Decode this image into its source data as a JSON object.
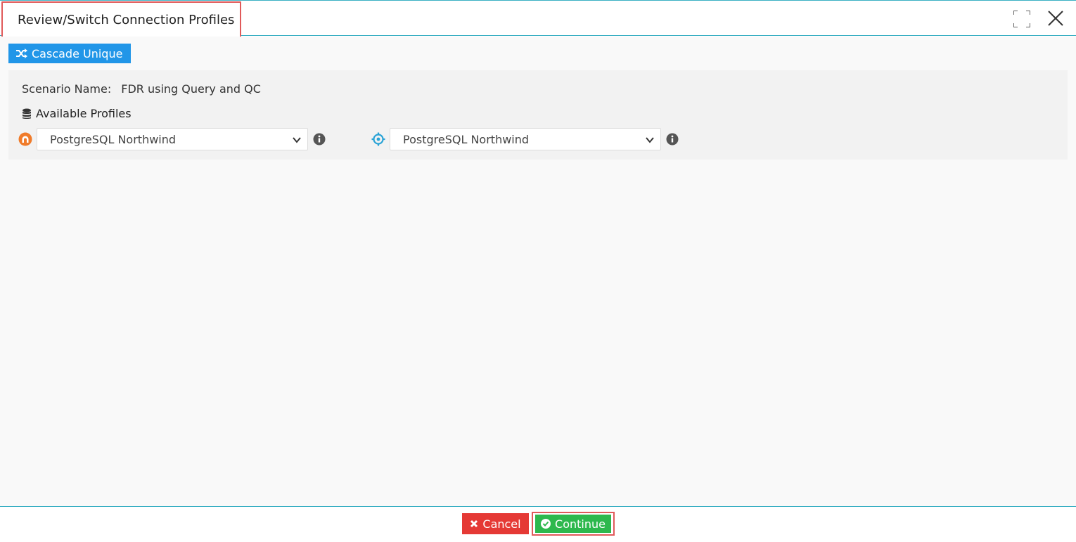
{
  "dialog": {
    "title": "Review/Switch Connection Profiles",
    "maximize_icon": "maximize-icon",
    "close_icon": "close-icon"
  },
  "toolbar": {
    "cascade_label": "Cascade Unique",
    "cascade_icon": "shuffle-icon",
    "cascade_color": "#2196e8"
  },
  "scenario": {
    "label": "Scenario Name:",
    "value": "FDR using Query and QC"
  },
  "profiles": {
    "label": "Available Profiles",
    "icon": "database-icon",
    "source": {
      "icon": "source-icon",
      "selected": "PostgreSQL Northwind"
    },
    "target": {
      "icon": "target-icon",
      "selected": "PostgreSQL Northwind"
    }
  },
  "footer": {
    "cancel_label": "Cancel",
    "cancel_color": "#e53935",
    "continue_label": "Continue",
    "continue_color": "#2db84d"
  }
}
